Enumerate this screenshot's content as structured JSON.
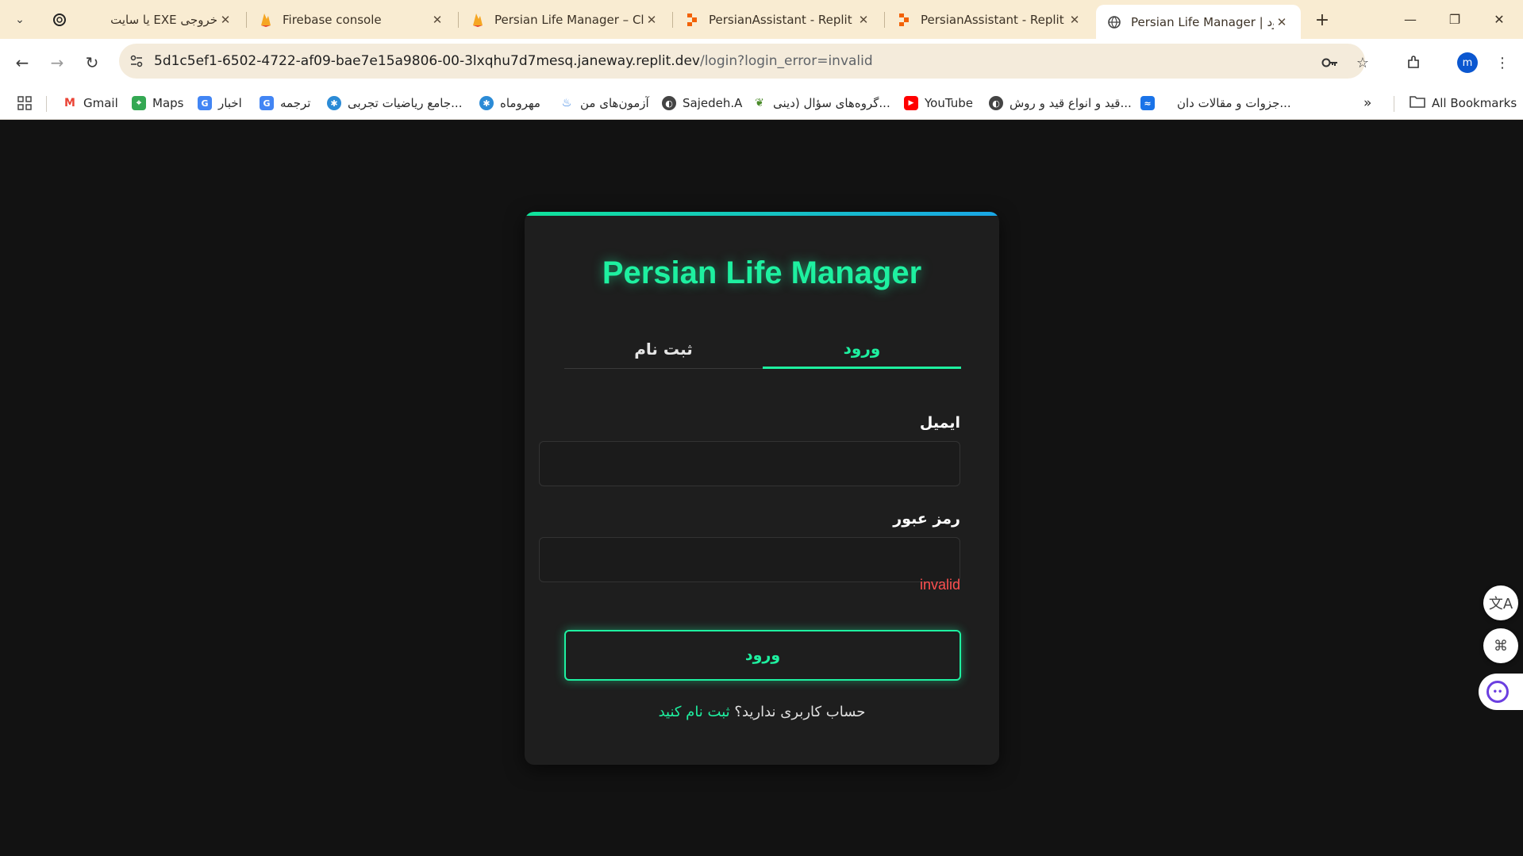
{
  "browser": {
    "tabs": [
      {
        "title": "خروجی EXE یا سایت",
        "icon": "openai-icon",
        "active": false
      },
      {
        "title": "Firebase console",
        "icon": "firebase-icon",
        "active": false
      },
      {
        "title": "Persian Life Manager – Clo",
        "icon": "firebase-icon",
        "active": false
      },
      {
        "title": "PersianAssistant - Replit",
        "icon": "replit-icon",
        "active": false
      },
      {
        "title": "PersianAssistant - Replit",
        "icon": "replit-icon",
        "active": false
      },
      {
        "title": "Persian Life Manager | ورود",
        "icon": "globe-icon",
        "active": true
      }
    ],
    "url_host": "5d1c5ef1-6502-4722-af09-bae7e15a9806-00-3lxqhu7d7mesq.janeway.replit.dev",
    "url_path": "/login?login_error=invalid",
    "profile_initial": "m",
    "bookmarks": [
      {
        "label": "Gmail",
        "icon": "gmail-icon",
        "color": "#ea4335"
      },
      {
        "label": "Maps",
        "icon": "maps-icon",
        "color": "#34a853"
      },
      {
        "label": "اخبار",
        "icon": "news-icon",
        "color": "#4285f4"
      },
      {
        "label": "ترجمه",
        "icon": "translate-icon",
        "color": "#4285f4"
      },
      {
        "label": "جامع ریاضیات تجربی...",
        "icon": "globe-icon",
        "color": "#2b8bd6"
      },
      {
        "label": "مهروماه",
        "icon": "globe-icon",
        "color": "#2b8bd6"
      },
      {
        "label": "آزمون‌های من",
        "icon": "flame-icon",
        "color": "#2f7de1"
      },
      {
        "label": "Sajedeh.A",
        "icon": "globe-icon",
        "color": "#444444"
      },
      {
        "label": "گروه‌های سؤال (دینی...",
        "icon": "leaf-icon",
        "color": "#4b8b2b"
      },
      {
        "label": "YouTube",
        "icon": "youtube-icon",
        "color": "#ff0000"
      },
      {
        "label": "قید و انواع قید و روش...",
        "icon": "globe-icon",
        "color": "#444444"
      },
      {
        "label": "جزوات و مقالات دان...",
        "icon": "chart-icon",
        "color": "#1a73e8"
      }
    ],
    "all_bookmarks_label": "All Bookmarks"
  },
  "login": {
    "app_title": "Persian Life Manager",
    "tab_login": "ورود",
    "tab_register": "ثبت نام",
    "email_label": "ایمیل",
    "email_value": "",
    "password_label": "رمز عبور",
    "password_value": "",
    "error": "invalid",
    "submit_label": "ورود",
    "no_account_text": "حساب کاربری ندارید؟",
    "register_link": "ثبت نام کنید",
    "accent_color": "#1ef0a0",
    "error_color": "#ff5050"
  }
}
